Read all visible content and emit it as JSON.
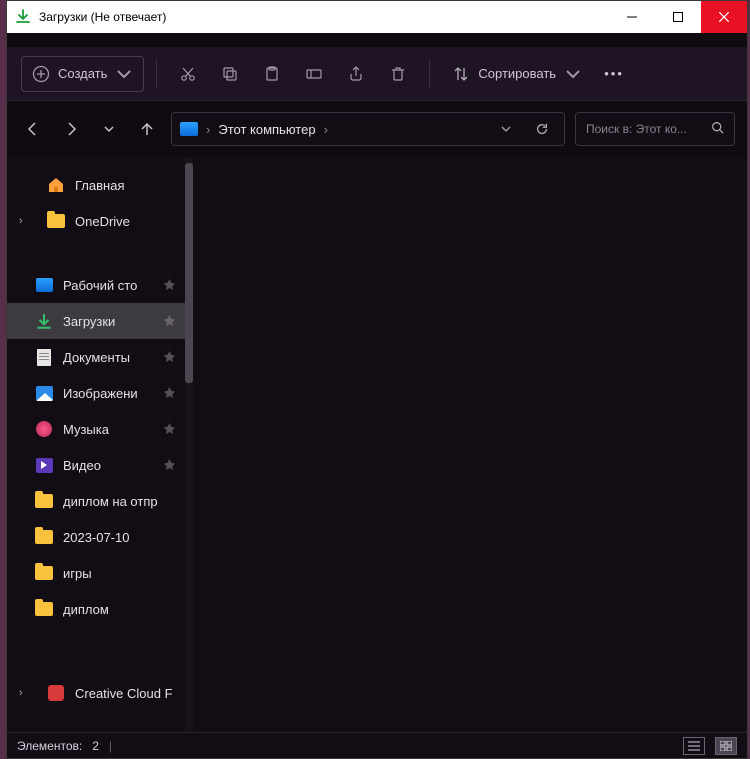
{
  "window": {
    "title": "Загрузки (Не отвечает)"
  },
  "toolbar": {
    "new_label": "Создать",
    "sort_label": "Сортировать"
  },
  "address": {
    "crumb": "Этот компьютер"
  },
  "search": {
    "placeholder": "Поиск в: Этот ко..."
  },
  "sidebar": {
    "home": "Главная",
    "onedrive": "OneDrive",
    "quick": [
      {
        "label": "Рабочий сто",
        "icon": "desktop",
        "pinned": true
      },
      {
        "label": "Загрузки",
        "icon": "downloads",
        "pinned": true,
        "selected": true
      },
      {
        "label": "Документы",
        "icon": "documents",
        "pinned": true
      },
      {
        "label": "Изображени",
        "icon": "pictures",
        "pinned": true
      },
      {
        "label": "Музыка",
        "icon": "music",
        "pinned": true
      },
      {
        "label": "Видео",
        "icon": "videos",
        "pinned": true
      },
      {
        "label": "диплом на отпр",
        "icon": "folder",
        "pinned": false
      },
      {
        "label": "2023-07-10",
        "icon": "folder",
        "pinned": false
      },
      {
        "label": "игры",
        "icon": "folder",
        "pinned": false
      },
      {
        "label": "диплом",
        "icon": "folder",
        "pinned": false
      }
    ],
    "creative": "Creative Cloud F"
  },
  "status": {
    "elements_label": "Элементов:",
    "elements_count": "2"
  }
}
